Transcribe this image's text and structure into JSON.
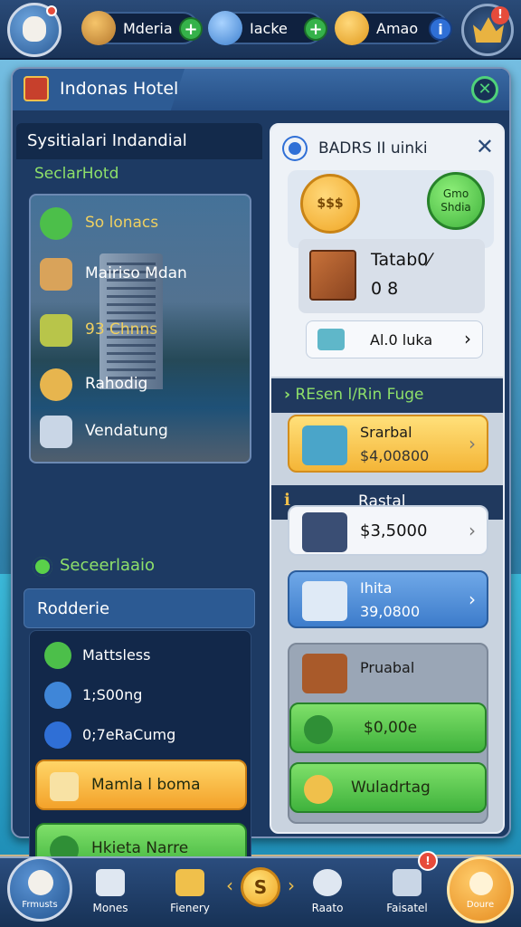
{
  "top_bar": {
    "resources": [
      {
        "label": "Mderia",
        "icon": "gem-icon",
        "action": "plus"
      },
      {
        "label": "Iacke",
        "icon": "crystal-icon",
        "action": "plus"
      },
      {
        "label": "Amao",
        "icon": "gold-coin-icon",
        "action": "info"
      }
    ],
    "plus_symbol": "+",
    "info_symbol": "i",
    "crown_alert": "!"
  },
  "window": {
    "title": "Indonas Hotel",
    "close_symbol": "✕"
  },
  "left_panel": {
    "header": "Sysitialari Indandial",
    "subheader": "SeclarHotd",
    "photo_items": [
      {
        "label": "So lonacs",
        "color": "#f0d060"
      },
      {
        "label": "Mairiso Mdan",
        "color": "#ffffff"
      },
      {
        "label": "93 Chnns",
        "color": "#f0d060"
      },
      {
        "label": "Rahodig",
        "color": "#ffffff"
      },
      {
        "label": "Vendatung",
        "color": "#ffffff"
      }
    ],
    "section_title": "Seceerlaaio",
    "rodderie_label": "Rodderie",
    "stats": [
      {
        "label": "Mattsless",
        "icon": "clock-icon"
      },
      {
        "label": "1;S00ng",
        "icon": "wrench-icon"
      },
      {
        "label": "0;7eRaCumg",
        "icon": "shield-icon"
      }
    ],
    "btn_orange": "Mamla l boma",
    "btn_green": "Hkieta Narre"
  },
  "right_panel": {
    "header": "BADRS II uinki",
    "close_symbol": "✕",
    "coin_label": "$$$",
    "green_badge": "Gmo Shdia",
    "tab_title": "Tatab0⁄",
    "tab_value": "0 8",
    "link_label": "Al.0 luka",
    "chevron": "›",
    "strip_title": "REsen l/Rin Fuge",
    "strip_prefix": "›",
    "items": [
      {
        "title": "Srarbal",
        "price": "$4,00800",
        "style": "yellow"
      },
      {
        "title": "",
        "price": "$3,5000",
        "style": "white"
      },
      {
        "title": "Ihita",
        "price": "39,0800",
        "style": "blue"
      }
    ],
    "strip2_label": "Rastal",
    "strip2_mark": "ℹ",
    "gray_label": "Pruabal",
    "btn_green1": "$0,00e",
    "btn_green2": "Wuladrtag"
  },
  "bottom_nav": {
    "home_label": "Frmusts",
    "items": [
      {
        "label": "Mones"
      },
      {
        "label": "Fienery"
      },
      {
        "label": "Raato"
      },
      {
        "label": "Faisatel"
      }
    ],
    "coin_symbol": "S",
    "left_arrow": "‹",
    "right_arrow": "›",
    "shop_label": "Doure",
    "badge_symbol": "!"
  },
  "colors": {
    "accent_green": "#8ee06a",
    "panel_blue": "#1d3a63",
    "gold": "#f0c04b"
  }
}
